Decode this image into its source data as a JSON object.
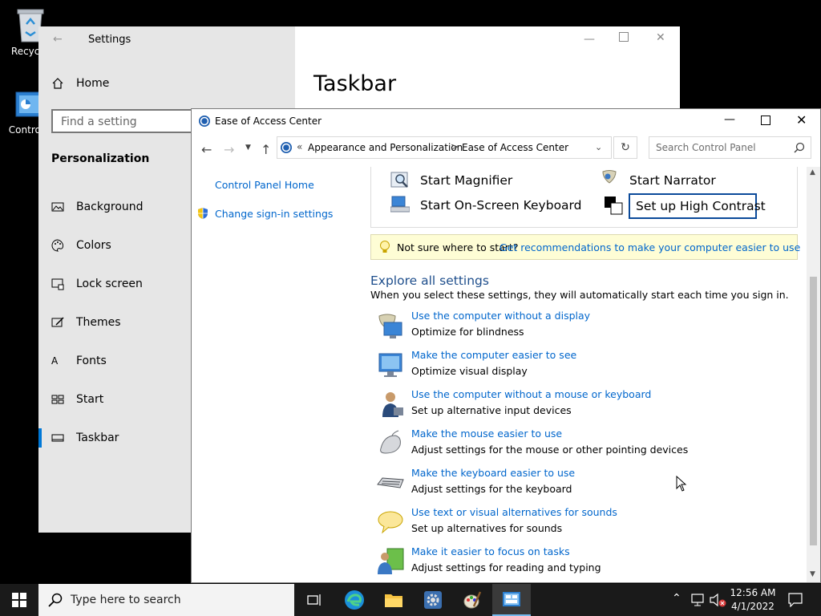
{
  "desktop": {
    "icons": [
      {
        "label": "Recycle"
      },
      {
        "label": "Control P"
      }
    ]
  },
  "settings": {
    "window_title": "Settings",
    "home_label": "Home",
    "search_placeholder": "Find a setting",
    "section_heading": "Personalization",
    "items": [
      {
        "label": "Background"
      },
      {
        "label": "Colors"
      },
      {
        "label": "Lock screen"
      },
      {
        "label": "Themes"
      },
      {
        "label": "Fonts"
      },
      {
        "label": "Start"
      },
      {
        "label": "Taskbar"
      }
    ],
    "page_title": "Taskbar"
  },
  "eac": {
    "window_title": "Ease of Access Center",
    "breadcrumb": {
      "prefix": "«",
      "items": [
        "Appearance and Personalization",
        "Ease of Access Center"
      ],
      "separator": ">"
    },
    "search_placeholder": "Search Control Panel",
    "left_nav": {
      "home": "Control Panel Home",
      "signin": "Change sign-in settings"
    },
    "quick_access": {
      "magnifier": "Start Magnifier",
      "narrator": "Start Narrator",
      "osk": "Start On-Screen Keyboard",
      "high_contrast": "Set up High Contrast"
    },
    "tip": {
      "text": "Not sure where to start?",
      "link": "Get recommendations to make your computer easier to use"
    },
    "explore": {
      "heading": "Explore all settings",
      "subtext": "When you select these settings, they will automatically start each time you sign in."
    },
    "categories": [
      {
        "title": "Use the computer without a display",
        "sub": "Optimize for blindness",
        "icon": "monitor-speaker-icon"
      },
      {
        "title": "Make the computer easier to see",
        "sub": "Optimize visual display",
        "icon": "monitor-icon"
      },
      {
        "title": "Use the computer without a mouse or keyboard",
        "sub": "Set up alternative input devices",
        "icon": "person-icon"
      },
      {
        "title": "Make the mouse easier to use",
        "sub": "Adjust settings for the mouse or other pointing devices",
        "icon": "mouse-icon"
      },
      {
        "title": "Make the keyboard easier to use",
        "sub": "Adjust settings for the keyboard",
        "icon": "keyboard-icon"
      },
      {
        "title": "Use text or visual alternatives for sounds",
        "sub": "Set up alternatives for sounds",
        "icon": "speech-bubble-icon"
      },
      {
        "title": "Make it easier to focus on tasks",
        "sub": "Adjust settings for reading and typing",
        "icon": "people-icon"
      }
    ]
  },
  "taskbar": {
    "search_placeholder": "Type here to search",
    "time": "12:56 AM",
    "date": "4/1/2022"
  },
  "colors": {
    "accent": "#0078d7",
    "link": "#0066cc",
    "tip_bg": "#fefdd5",
    "taskbar_bg": "#1a1a1a"
  }
}
